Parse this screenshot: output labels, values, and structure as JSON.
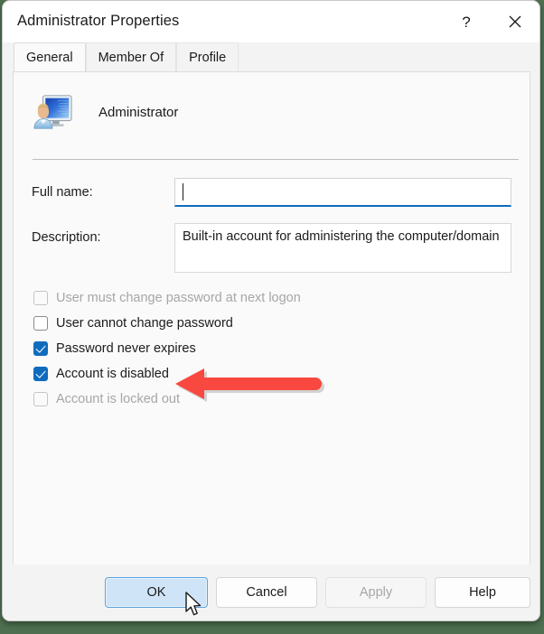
{
  "window": {
    "title": "Administrator Properties",
    "help_button": "?",
    "close_button": "✕",
    "help_icon": "question-mark-icon",
    "close_icon": "close-icon"
  },
  "tabs": [
    {
      "label": "General",
      "selected": true
    },
    {
      "label": "Member Of",
      "selected": false
    },
    {
      "label": "Profile",
      "selected": false
    }
  ],
  "general": {
    "account_icon": "user-account-icon",
    "account_name": "Administrator",
    "fields": {
      "full_name_label": "Full name:",
      "full_name_value": "",
      "full_name_placeholder": "",
      "description_label": "Description:",
      "description_value": "Built-in account for administering the computer/domain"
    },
    "checkboxes": [
      {
        "label": "User must change password at next logon",
        "checked": false,
        "disabled": true
      },
      {
        "label": "User cannot change password",
        "checked": false,
        "disabled": false
      },
      {
        "label": "Password never expires",
        "checked": true,
        "disabled": false
      },
      {
        "label": "Account is disabled",
        "checked": true,
        "disabled": false
      },
      {
        "label": "Account is locked out",
        "checked": false,
        "disabled": true
      }
    ]
  },
  "footer": {
    "ok_label": "OK",
    "cancel_label": "Cancel",
    "apply_label": "Apply",
    "help_label": "Help"
  },
  "annotation": {
    "arrow_icon": "red-left-arrow-annotation",
    "arrow_color": "#f9483f",
    "points_at": "Account is disabled"
  },
  "cursor": {
    "icon": "mouse-pointer-cursor"
  },
  "colors": {
    "accent": "#0f6cbd",
    "desktop_background": "#4e7050",
    "window_background": "#f3f3f3",
    "panel_background": "#fafafa",
    "annotation_red": "#f9483f",
    "ok_button_highlight": "#cfe4f7"
  }
}
